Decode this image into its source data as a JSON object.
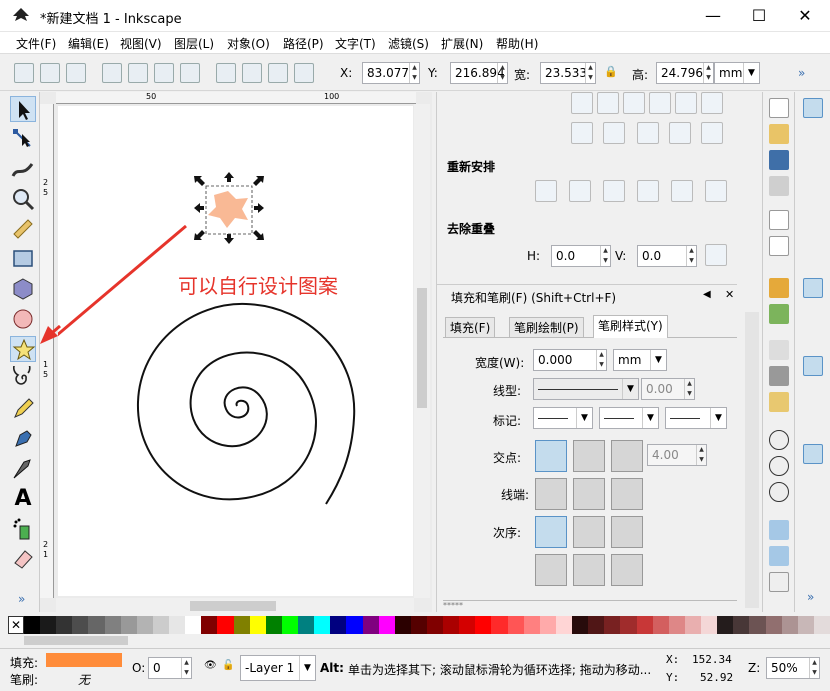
{
  "window": {
    "title": "*新建文档 1 - Inkscape",
    "minimize": "—",
    "maximize": "☐",
    "close": "✕"
  },
  "menu": [
    "文件(F)",
    "编辑(E)",
    "视图(V)",
    "图层(L)",
    "对象(O)",
    "路径(P)",
    "文字(T)",
    "滤镜(S)",
    "扩展(N)",
    "帮助(H)"
  ],
  "toolbar": {
    "x_label": "X:",
    "x_value": "83.077",
    "y_label": "Y:",
    "y_value": "216.894",
    "w_label": "宽:",
    "w_value": "23.533",
    "h_label": "高:",
    "h_value": "24.796",
    "unit": "mm",
    "more": "»"
  },
  "canvas": {
    "annotation": "可以自行设计图案",
    "ruler_marks": [
      "50",
      "100"
    ],
    "left_ruler": [
      "2",
      "5",
      "1",
      "5",
      "2",
      "1"
    ],
    "star_fill": "#f9b995",
    "arrow_color": "#e6342b"
  },
  "dock": {
    "rearrange_title": "重新安排",
    "overlap_title": "去除重叠",
    "h_label": "H:",
    "h_value": "0.0",
    "v_label": "V:",
    "v_value": "0.0",
    "fill_stroke_title": "填充和笔刷(F) (Shift+Ctrl+F)",
    "tabs": [
      "填充(F)",
      "笔刷绘制(P)",
      "笔刷样式(Y)"
    ],
    "width_label": "宽度(W):",
    "width_value": "0.000",
    "width_unit": "mm",
    "dash_label": "线型:",
    "dash_value": "0.00",
    "marker_label": "标记:",
    "join_label": "交点:",
    "join_value": "4.00",
    "cap_label": "线端:",
    "order_label": "次序:",
    "footer": "*****"
  },
  "palette_colors": [
    "#000000",
    "#1a1a1a",
    "#333333",
    "#4d4d4d",
    "#666666",
    "#808080",
    "#999999",
    "#b3b3b3",
    "#cccccc",
    "#e6e6e6",
    "#ffffff",
    "#800000",
    "#ff0000",
    "#808000",
    "#ffff00",
    "#008000",
    "#00ff00",
    "#008080",
    "#00ffff",
    "#000080",
    "#0000ff",
    "#800080",
    "#ff00ff",
    "#2b0000",
    "#550000",
    "#800000",
    "#aa0000",
    "#d40000",
    "#ff0000",
    "#ff2a2a",
    "#ff5555",
    "#ff8080",
    "#ffaaaa",
    "#ffd5d5",
    "#280b0b",
    "#501616",
    "#782121",
    "#a02c2c",
    "#c83737",
    "#d35f5f",
    "#de8787",
    "#e9afaf",
    "#f4d7d7",
    "#241c1c",
    "#483737",
    "#6c5353",
    "#916f6f",
    "#ac9393",
    "#c8b7b7",
    "#e3dbdb"
  ],
  "status": {
    "fill_label": "填充:",
    "stroke_label": "笔刷:",
    "stroke_value": "无",
    "fill_color": "#ff8c3a",
    "opacity_label": "O:",
    "opacity_value": "0",
    "layer": "-Layer 1",
    "message_key": "Alt:",
    "message": "单击为选择其下; 滚动鼠标滑轮为循环选择; 拖动为移动...",
    "x_label": "X:",
    "x_value": "152.34",
    "y_label": "Y:",
    "y_value": "52.92",
    "z_label": "Z:",
    "zoom": "50%"
  }
}
